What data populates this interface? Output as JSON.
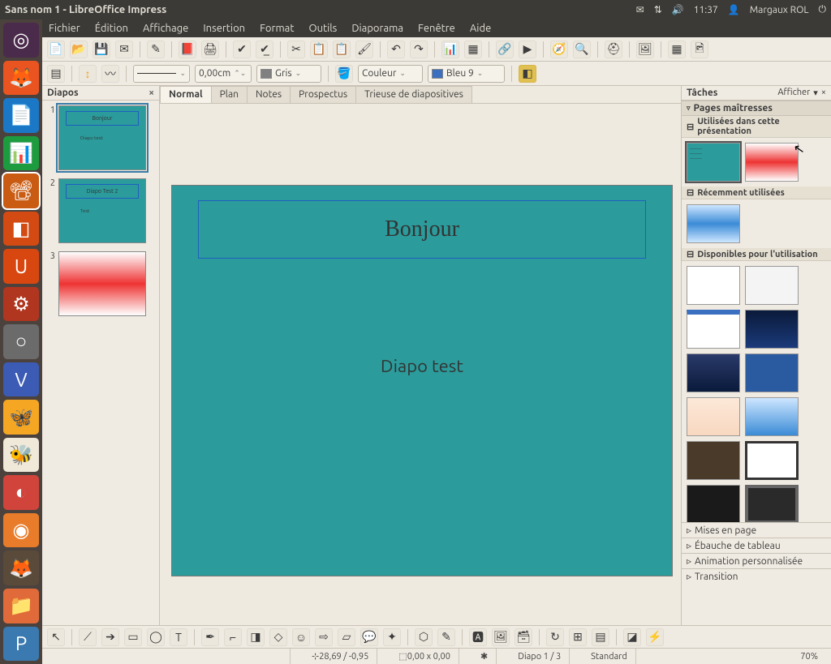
{
  "window_title": "Sans nom 1 - LibreOffice Impress",
  "desktop": {
    "time": "11:37",
    "user": "Margaux ROL"
  },
  "menu": {
    "items": [
      "Fichier",
      "Édition",
      "Affichage",
      "Insertion",
      "Format",
      "Outils",
      "Diaporama",
      "Fenêtre",
      "Aide"
    ]
  },
  "toolbar2": {
    "line_width": "0,00cm",
    "line_color_label": "Gris",
    "fill_mode_label": "Couleur",
    "fill_color_label": "Bleu 9"
  },
  "slide_panel": {
    "title": "Diapos"
  },
  "slides": [
    {
      "n": "1",
      "title": "Bonjour",
      "body": "Diapo test",
      "style": "teal"
    },
    {
      "n": "2",
      "title": "Diapo Test 2",
      "body": "Test",
      "style": "teal"
    },
    {
      "n": "3",
      "title": "",
      "body": "",
      "style": "red"
    }
  ],
  "selected_slide": 0,
  "view_tabs": [
    "Normal",
    "Plan",
    "Notes",
    "Prospectus",
    "Trieuse de diapositives"
  ],
  "active_view_tab": 0,
  "current_slide": {
    "title": "Bonjour",
    "body": "Diapo test"
  },
  "tasks": {
    "title": "Tâches",
    "display_label": "Afficher",
    "master_section": "Pages maîtresses",
    "used_in_pres": "Utilisées dans cette présentation",
    "recently_used": "Récemment utilisées",
    "available": "Disponibles pour l'utilisation",
    "bottom": [
      "Mises en page",
      "Ébauche de tableau",
      "Animation personnalisée",
      "Transition"
    ]
  },
  "status": {
    "coords": "28,69 / -0,95",
    "size": "0,00 x 0,00",
    "slide_info": "Diapo 1 / 3",
    "layout": "Standard",
    "zoom": "70%"
  }
}
